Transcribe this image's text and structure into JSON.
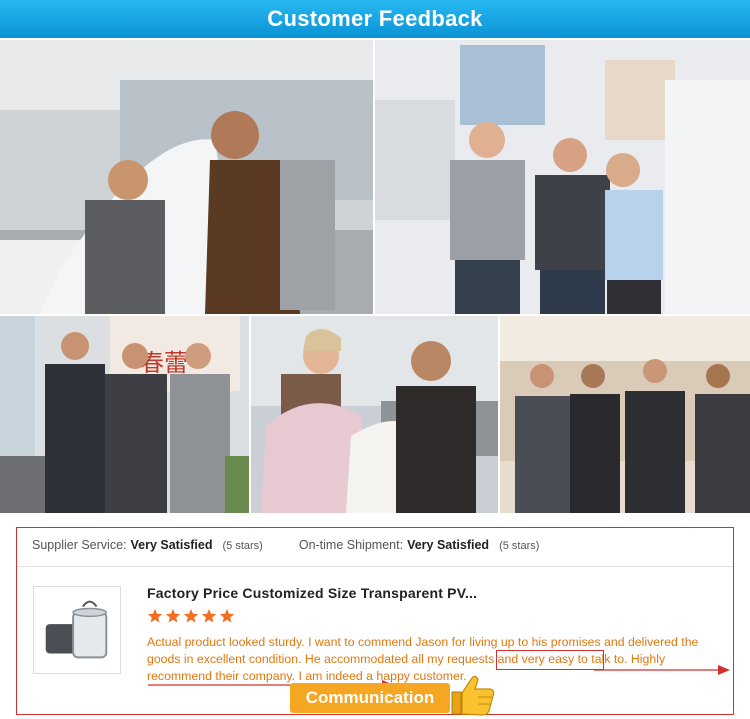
{
  "banner": {
    "title": "Customer Feedback"
  },
  "photos": [
    {
      "name": "photo-factory-inspection"
    },
    {
      "name": "photo-trade-fair-booth"
    },
    {
      "name": "photo-office-visit"
    },
    {
      "name": "photo-pillow-inspection"
    },
    {
      "name": "photo-business-meeting"
    }
  ],
  "ratings": {
    "supplier_label": "Supplier Service:",
    "supplier_value": "Very Satisfied",
    "supplier_stars": "(5 stars)",
    "shipment_label": "On-time Shipment:",
    "shipment_value": "Very Satisfied",
    "shipment_stars": "(5 stars)"
  },
  "review": {
    "product_title": "Factory Price Customized Size Transparent PV...",
    "star_count": 5,
    "star_color": "#f36f21",
    "text": "Actual product looked sturdy. I want to commend Jason for living up to his promises and delivered the goods in excellent condition. He accommodated all my requests and very easy to talk to. Highly recommend their company. I am indeed a happy customer."
  },
  "badge": {
    "label": "Communication",
    "icon": "thumbs-up-icon"
  },
  "colors": {
    "banner": "#18a6e6",
    "accent_red": "#d32f2f",
    "review_text": "#e0780f",
    "badge": "#f5a623"
  }
}
